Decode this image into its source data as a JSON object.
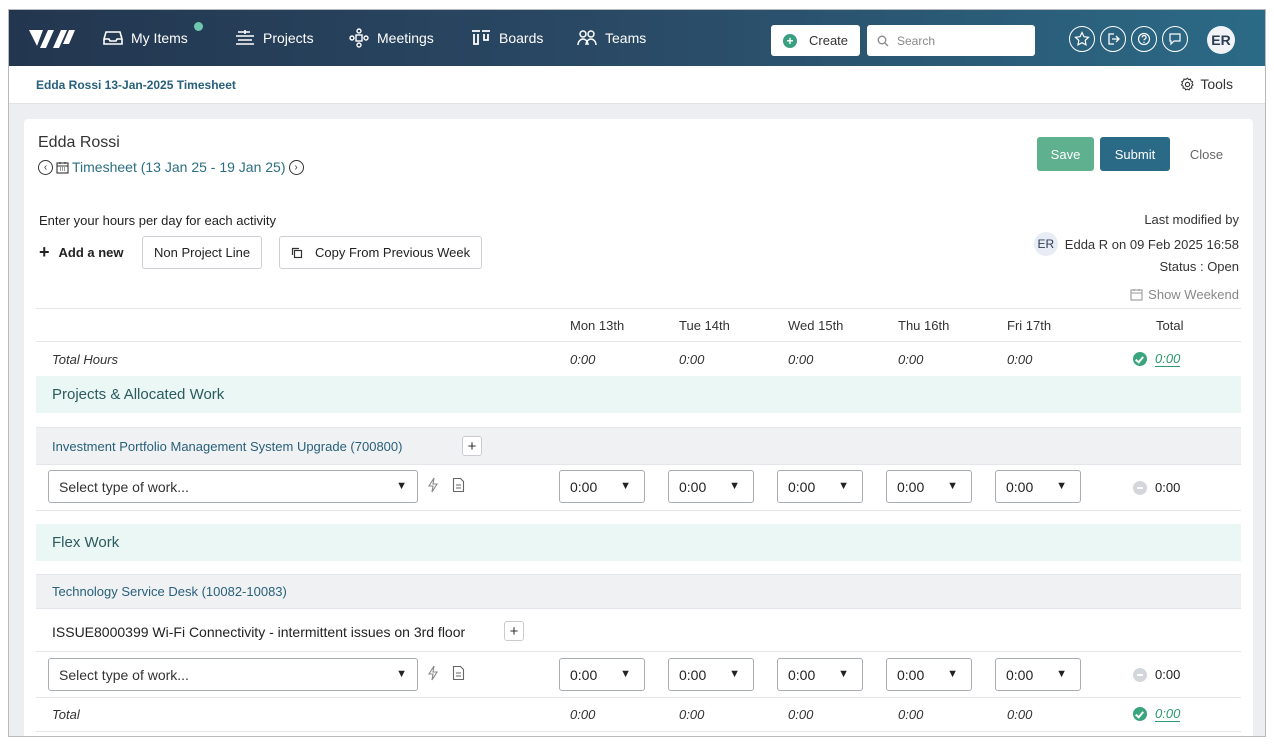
{
  "nav": {
    "items": [
      {
        "label": "My Items",
        "icon": "inbox-icon"
      },
      {
        "label": "Projects",
        "icon": "projects-icon"
      },
      {
        "label": "Meetings",
        "icon": "meetings-icon"
      },
      {
        "label": "Boards",
        "icon": "boards-icon"
      },
      {
        "label": "Teams",
        "icon": "teams-icon"
      }
    ],
    "create_label": "Create",
    "search_placeholder": "Search",
    "avatar_initials": "ER",
    "accent": "#2b6a86",
    "badge_color": "#6fc7b0"
  },
  "subheader": {
    "breadcrumb": "Edda Rossi 13-Jan-2025 Timesheet",
    "tools_label": "Tools"
  },
  "timesheet": {
    "employee": "Edda Rossi",
    "period": "Timesheet (13 Jan 25 - 19 Jan 25)",
    "buttons": {
      "save": "Save",
      "submit": "Submit",
      "close": "Close"
    },
    "instructions": "Enter your hours per day for each activity",
    "add_new": "Add a new",
    "non_project_line": "Non Project Line",
    "copy_prev": "Copy From Previous Week",
    "last_modified_label": "Last modified by",
    "modified_initials": "ER",
    "modified_by": "Edda R on 09 Feb 2025 16:58",
    "status": "Status : Open",
    "show_weekend": "Show Weekend",
    "columns": [
      "Mon 13th",
      "Tue 14th",
      "Wed 15th",
      "Thu 16th",
      "Fri 17th"
    ],
    "total_col": "Total",
    "total_hours": {
      "label": "Total Hours",
      "values": [
        "0:00",
        "0:00",
        "0:00",
        "0:00",
        "0:00"
      ],
      "total": "0:00"
    },
    "sections": [
      {
        "title": "Projects & Allocated Work",
        "project": "Investment Portfolio Management System Upgrade (700800)",
        "work_placeholder": "Select type of work...",
        "hours": [
          "0:00",
          "0:00",
          "0:00",
          "0:00",
          "0:00"
        ],
        "total": "0:00"
      },
      {
        "title": "Flex Work",
        "project": "Technology Service Desk (10082-10083)",
        "issue": "ISSUE8000399 Wi-Fi Connectivity - intermittent issues on 3rd floor",
        "work_placeholder": "Select type of work...",
        "hours": [
          "0:00",
          "0:00",
          "0:00",
          "0:00",
          "0:00"
        ],
        "total": "0:00"
      }
    ],
    "footer_total": {
      "label": "Total",
      "values": [
        "0:00",
        "0:00",
        "0:00",
        "0:00",
        "0:00"
      ],
      "total": "0:00"
    }
  }
}
